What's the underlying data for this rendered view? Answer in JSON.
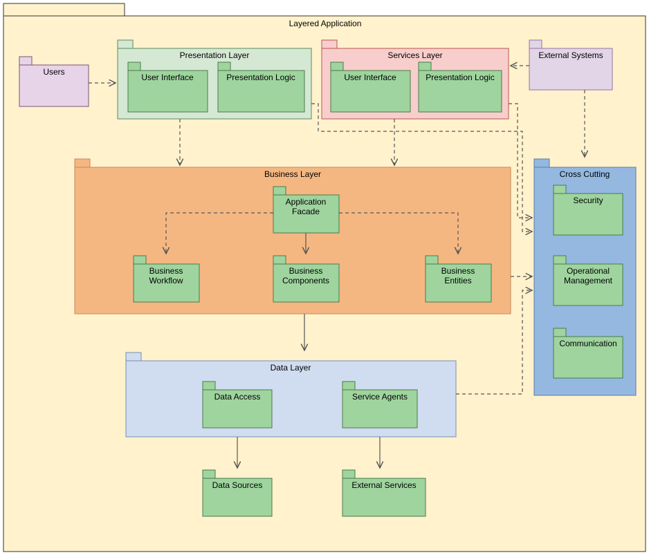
{
  "title": "Layered Application",
  "packages": {
    "users": "Users",
    "presentation_layer": "Presentation Layer",
    "user_interface": "User Interface",
    "presentation_logic": "Presentation Logic",
    "services_layer": "Services Layer",
    "services_ui": "User Interface",
    "services_logic": "Presentation Logic",
    "external_systems": "External Systems",
    "business_layer": "Business Layer",
    "application_facade": "Application Facade",
    "business_workflow": "Business Workflow",
    "business_components": "Business Components",
    "business_entities": "Business Entities",
    "data_layer": "Data Layer",
    "data_access": "Data Access",
    "service_agents": "Service Agents",
    "data_sources": "Data Sources",
    "external_services": "External Services",
    "cross_cutting": "Cross Cutting",
    "security": "Security",
    "operational_management": "Operational Management",
    "communication": "Communication"
  },
  "colors": {
    "main_bg": "#FFF2CC",
    "main_stroke": "#333",
    "users_bg": "#E8D4E8",
    "users_stroke": "#7A527A",
    "presentation_bg": "#D5E8D4",
    "presentation_stroke": "#5A8A5A",
    "services_bg": "#F8CECC",
    "services_stroke": "#B85450",
    "external_bg": "#E1D5E7",
    "external_stroke": "#9673A6",
    "business_bg": "#F5B782",
    "business_stroke": "#C8875A",
    "data_bg": "#D0DCF0",
    "data_stroke": "#7A8FB0",
    "cross_bg": "#94B8E0",
    "cross_stroke": "#5A7AA8",
    "inner_bg": "#9FD49F",
    "inner_stroke": "#4A7A4A",
    "arrow": "#555"
  }
}
